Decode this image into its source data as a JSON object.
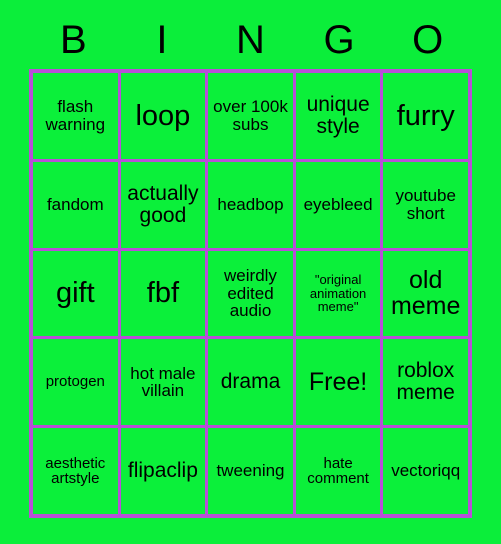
{
  "card": {
    "background_color": "#0bee3a",
    "cell_color": "#0bf03a",
    "grid_line_color": "#b84fd8",
    "text_color": "#000000",
    "header": {
      "letters": [
        {
          "label": "B"
        },
        {
          "label": "I"
        },
        {
          "label": "N"
        },
        {
          "label": "G"
        },
        {
          "label": "O"
        }
      ]
    },
    "grid": {
      "columns": 5,
      "rows": 5,
      "cells": [
        {
          "label": "flash warning",
          "size": "sm"
        },
        {
          "label": "loop",
          "size": "xl"
        },
        {
          "label": "over 100k subs",
          "size": "sm"
        },
        {
          "label": "unique style",
          "size": "md"
        },
        {
          "label": "furry",
          "size": "xl"
        },
        {
          "label": "fandom",
          "size": "sm"
        },
        {
          "label": "actually good",
          "size": "md"
        },
        {
          "label": "headbop",
          "size": "sm"
        },
        {
          "label": "eyebleed",
          "size": "sm"
        },
        {
          "label": "youtube short",
          "size": "sm"
        },
        {
          "label": "gift",
          "size": "xl"
        },
        {
          "label": "fbf",
          "size": "xl"
        },
        {
          "label": "weirdly edited audio",
          "size": "sm"
        },
        {
          "label": "\"original animation meme\"",
          "size": "xxs"
        },
        {
          "label": "old meme",
          "size": "lg"
        },
        {
          "label": "protogen",
          "size": "xs"
        },
        {
          "label": "hot male villain",
          "size": "sm"
        },
        {
          "label": "drama",
          "size": "md"
        },
        {
          "label": "Free!",
          "size": "lg"
        },
        {
          "label": "roblox meme",
          "size": "md"
        },
        {
          "label": "aesthetic artstyle",
          "size": "xs"
        },
        {
          "label": "flipaclip",
          "size": "md"
        },
        {
          "label": "tweening",
          "size": "sm"
        },
        {
          "label": "hate comment",
          "size": "xs"
        },
        {
          "label": "vectoriqq",
          "size": "sm"
        }
      ]
    }
  }
}
